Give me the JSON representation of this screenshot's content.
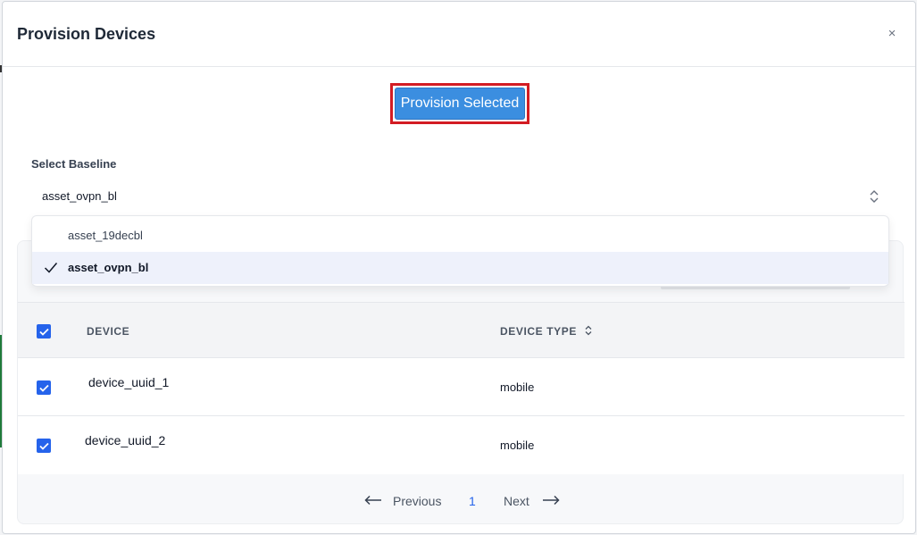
{
  "modal": {
    "title": "Provision Devices",
    "close_label": "×"
  },
  "actions": {
    "provision_label": "Provision Selected"
  },
  "baseline": {
    "label": "Select Baseline",
    "value": "asset_ovpn_bl",
    "options": [
      {
        "label": "asset_19decbl",
        "selected": false
      },
      {
        "label": "asset_ovpn_bl",
        "selected": true
      }
    ]
  },
  "table": {
    "columns": [
      "DEVICE",
      "DEVICE TYPE"
    ],
    "rows": [
      {
        "device": "device_uuid_1",
        "type": "mobile",
        "checked": true
      },
      {
        "device": "device_uuid_2",
        "type": "mobile",
        "checked": true
      }
    ],
    "select_all_checked": true
  },
  "pagination": {
    "prev_label": "Previous",
    "current_page": "1",
    "next_label": "Next"
  },
  "colors": {
    "primary": "#3b8ee0",
    "highlight_border": "#d31c23",
    "checkbox": "#2563eb"
  }
}
